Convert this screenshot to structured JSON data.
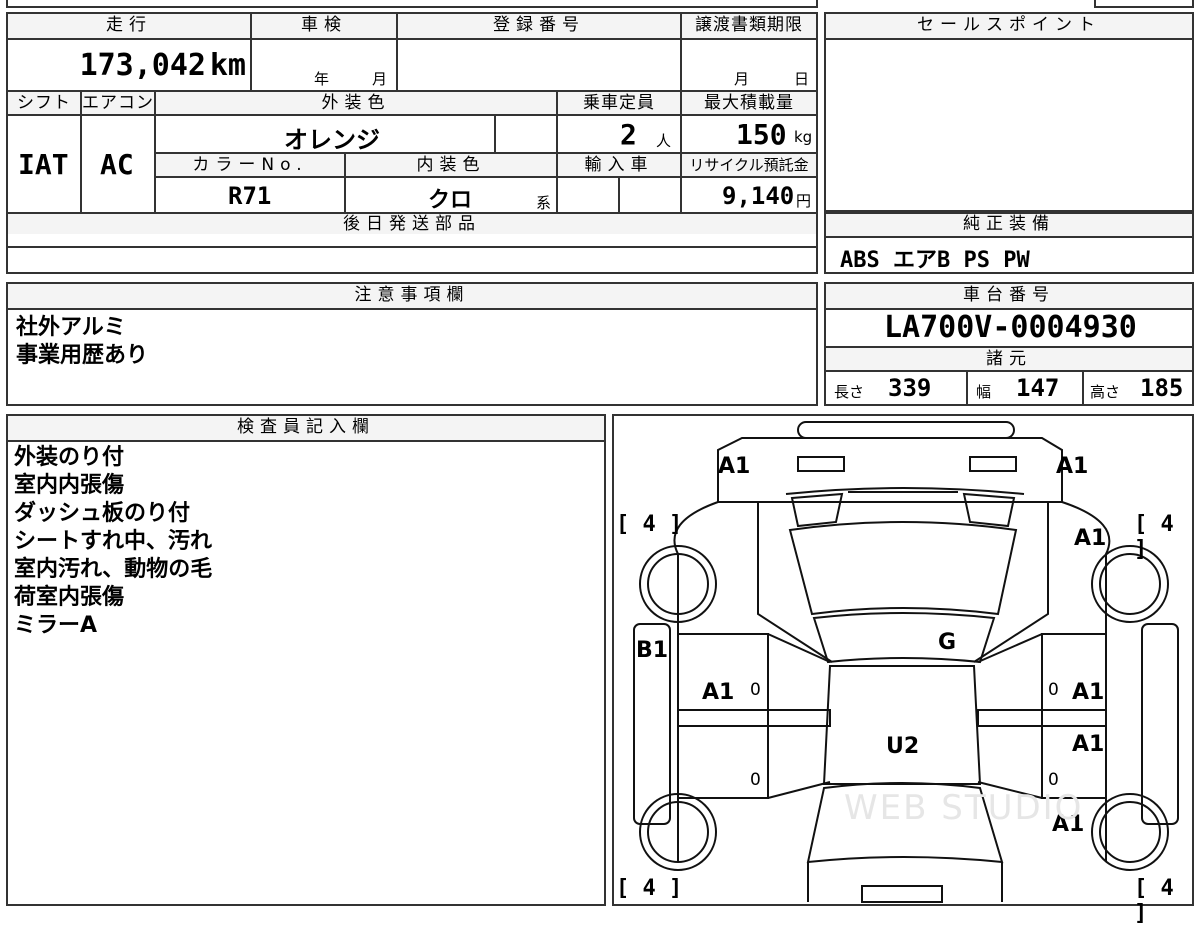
{
  "labels": {
    "mileage": "走行",
    "inspection": "車検",
    "registration": "登録番号",
    "transfer_deadline": "譲渡書類期限",
    "sales_point": "セールスポイント",
    "shift": "シフト",
    "aircon": "エアコン",
    "exterior_color": "外装色",
    "capacity": "乗車定員",
    "max_load": "最大積載量",
    "color_no": "カラーNo.",
    "interior_color": "内装色",
    "import": "輸入車",
    "recycle_fee": "リサイクル預託金",
    "later_parts": "後日発送部品",
    "genuine_equipment": "純正装備",
    "notes": "注意事項欄",
    "chassis_no": "車台番号",
    "specs": "諸元",
    "length": "長さ",
    "width": "幅",
    "height": "高さ",
    "inspector": "検査員記入欄"
  },
  "values": {
    "mileage": "173,042",
    "mileage_unit": "km",
    "year_unit": "年",
    "month_unit": "月",
    "deadline_month": "月",
    "deadline_day": "日",
    "shift": "IAT",
    "aircon": "AC",
    "exterior_color": "オレンジ",
    "capacity": "2",
    "capacity_unit": "人",
    "max_load": "150",
    "max_load_unit": "kg",
    "color_no": "R71",
    "interior_color": "クロ",
    "interior_suffix": "系",
    "recycle_fee": "9,140",
    "recycle_unit": "円",
    "genuine_equipment": "ABS エアB PS PW",
    "chassis_no": "LA700V-0004930",
    "length": "339",
    "width": "147",
    "height": "185"
  },
  "notes": [
    "社外アルミ",
    "事業用歴あり"
  ],
  "inspector_notes": [
    "外装のり付",
    "室内内張傷",
    "ダッシュ板のり付",
    "シートすれ中、汚れ",
    "室内汚れ、動物の毛",
    "荷室内張傷",
    "ミラーA"
  ],
  "diagram": {
    "marks": [
      "A1",
      "A1",
      "A1",
      "A1",
      "A1",
      "A1",
      "A1",
      "B1",
      "G",
      "U2"
    ],
    "tread": [
      "4",
      "4",
      "4",
      "4"
    ],
    "zero": "0",
    "watermark": "WEB STUDIO"
  }
}
